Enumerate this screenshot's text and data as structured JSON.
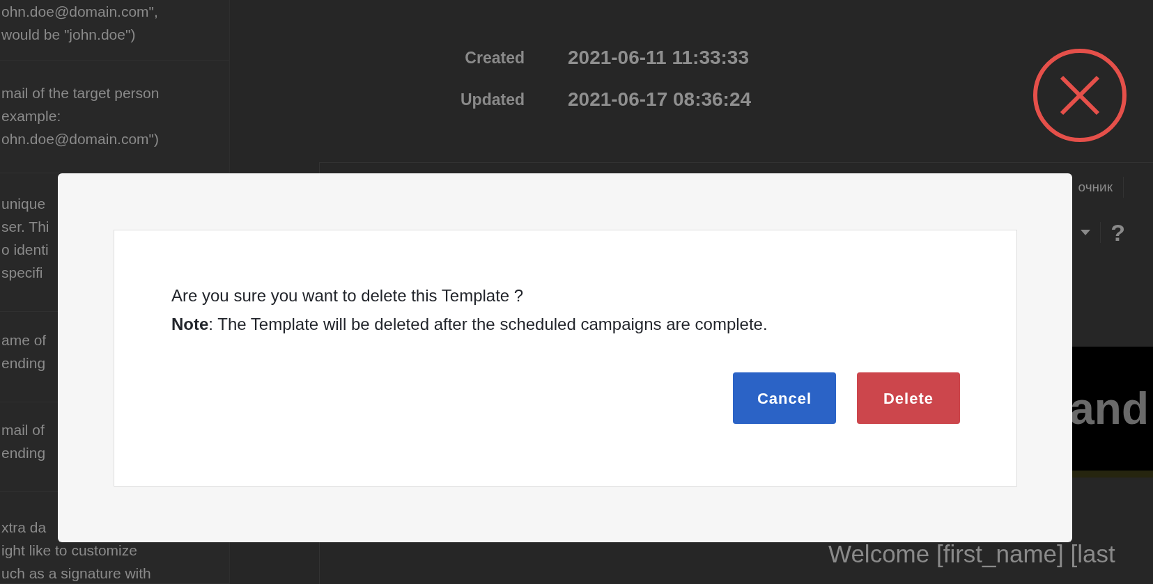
{
  "help_rows": [
    {
      "lines": [
        "ohn.doe@domain.com\",",
        "would be \"john.doe\")"
      ]
    },
    {
      "lines": [
        "mail of the target person",
        "example:",
        "ohn.doe@domain.com\")"
      ]
    },
    {
      "lines": [
        "unique",
        "ser. Thi",
        "o identi",
        "specifi"
      ]
    },
    {
      "lines": [
        "ame of",
        "ending"
      ]
    },
    {
      "lines": [
        "mail of",
        "ending"
      ]
    },
    {
      "lines": [
        "xtra da",
        "ight like to customize",
        "uch as a signature with"
      ]
    }
  ],
  "meta": [
    {
      "label": "Created",
      "value": "2021-06-11 11:33:33"
    },
    {
      "label": "Updated",
      "value": "2021-06-17 08:36:24"
    }
  ],
  "editor": {
    "toolbar_text": "очник",
    "help_symbol": "?",
    "banner_text": "and",
    "body_text": "Welcome [first_name] [last"
  },
  "dialog": {
    "message": "Are you sure you want to delete this Template ?",
    "note": "**Note**: The Template will be deleted after the scheduled campaigns are complete.",
    "buttons": [
      {
        "label": "Cancel",
        "kind": "secondary"
      },
      {
        "label": "Delete",
        "kind": "danger"
      }
    ]
  }
}
